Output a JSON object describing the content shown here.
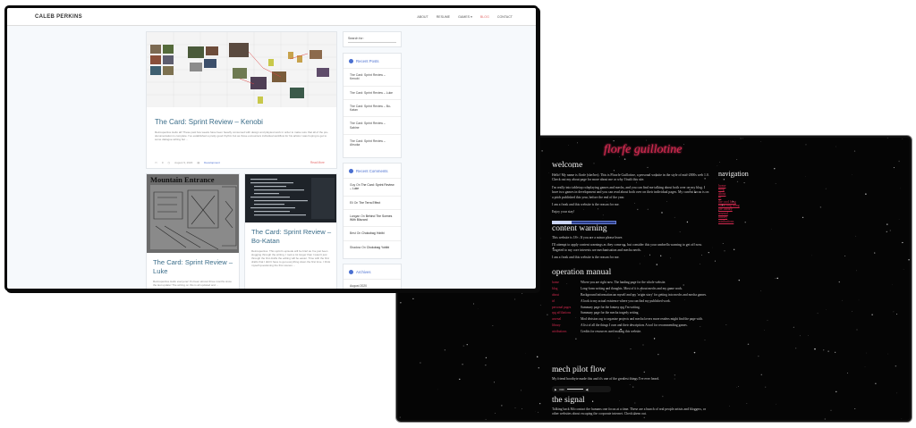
{
  "blog": {
    "brand": "CALEB PERKINS",
    "nav": [
      {
        "label": "ABOUT",
        "active": false
      },
      {
        "label": "RESUME",
        "active": false
      },
      {
        "label": "GAMES ▾",
        "active": false
      },
      {
        "label": "BLOG",
        "active": true
      },
      {
        "label": "CONTACT",
        "active": false
      }
    ],
    "posts": [
      {
        "title": "The Card: Sprint Review – Kenobi",
        "excerpt": "Retrospective Hello all! These past few weeks have been heavily consumed with design and playtest work in order to make sure that all of the pre-documentation is complete. I've established a pretty good rhythm but as those encounters individual workflow for his artists I was hoping to get to some dialogue writing but ...",
        "comments": "0",
        "date": "August 9, 2020",
        "category": "Development",
        "read_more": "Read More"
      },
      {
        "title": "The Card: Sprint Review – Luke",
        "excerpt": "Retrospective Hello everyone! It's been almost three months since the last update! The writing on this is all updated and ..."
      },
      {
        "title": "The Card: Sprint Review – Bo-Katan",
        "excerpt": "Retrospective: This sprint's episode will be brief as I've just been slogging through the writing. I took a lot longer than I wasn't just through the first drafts the editing will be easier. Time with the first drafts that I didn't have to get everything down the first time. I think myself questioning the first scenes ..."
      }
    ],
    "thumb_luke_caption": "Mountain Entrance",
    "search_placeholder": "Search for:",
    "recent_posts_title": "Recent Posts",
    "recent_posts": [
      "The Card: Sprint Review – Kenobi",
      "The Card: Sprint Review – Luke",
      "The Card: Sprint Review – Bo-Katan",
      "The Card: Sprint Review – Sabine",
      "The Card: Sprint Review – Ahsoka"
    ],
    "recent_comments_title": "Recent Comments",
    "recent_comments": [
      {
        "author": "Guy",
        "on": "On",
        "post": "The Card: Sprint Review – Luke"
      },
      {
        "author": "Eli",
        "on": "On",
        "post": "The Terra Effect"
      },
      {
        "author": "Langan",
        "on": "On",
        "post": "Behind The Scenes With Blizzard"
      },
      {
        "author": "Best",
        "on": "On",
        "post": "Chokobag Yobibi"
      },
      {
        "author": "Shadow",
        "on": "On",
        "post": "Chokobag Yobibi"
      }
    ],
    "archives_title": "Archives",
    "archives": [
      "August 2020"
    ]
  },
  "dark": {
    "site_title": "florfe guillotine",
    "welcome_heading": "welcome",
    "welcome_paragraphs": [
      "Hello! My name is florfe (she/her). This is Floorfe Guillotine, a personal website in the style of mid-2000s web 1.0. Check out my about page for more about me or why I built this site.",
      "I'm really into tabletop roleplaying games and mechs, and you can find me talking about both over on my blog. I have two games in development and you can read about both over on their individual pages. My current focus is on a pitch published this year, before the end of the year.",
      "I am a freak and this website is the reason for me.",
      "Enjoy your stay!"
    ],
    "warning_heading": "content warning",
    "warning_paragraphs": [
      "This website is 18+. If you are a minor please leave.",
      "I'll attempt to apply content warnings as they come up, but consider this your umbrella warning to get off now. Targeted to my core interests are mechanisation and mecha nerds.",
      "I am a freak and this website is the reason for me."
    ],
    "manual_heading": "operation manual",
    "manual": [
      {
        "key": "home",
        "value": "Where you are right now. The landing page for the whole website."
      },
      {
        "key": "blog",
        "value": "Long-form writing and thoughts. Most of it is about mechs and my game work."
      },
      {
        "key": "about",
        "value": "Background information on myself and my 'origin story' for getting into mechs and mecha games."
      },
      {
        "key": "irl",
        "value": "A look to my actual existence where you can find my published work."
      },
      {
        "key": "personal pages",
        "value": "Summary page for the fantasy rpg I'm writing."
      },
      {
        "key": "rpg affiliations",
        "value": "Summary page for the mecha tragedy setting."
      },
      {
        "key": "arsenal",
        "value": "Mod division org to organize projects and mecha lovers more readers might find the page with."
      },
      {
        "key": "library",
        "value": "A list of all the things I own and their description. A tool for recommending games."
      },
      {
        "key": "attributions",
        "value": "Credits for resources used making this website."
      }
    ],
    "mech_heading": "mech pilot flow",
    "mech_text": "My friend bootbyte made this and it's one of the greatest things I've ever heard.",
    "audio_time": "0:00",
    "signal_heading": "the signal",
    "signal_text": "Talking back 8th contact the humans one focus at a time. These are a bunch of real people artists and bloggers, or other websites about escaping the corporate internet. Check them out.",
    "nav_heading": "navigation",
    "nav_items": [
      "home",
      "blog",
      "about",
      "irl",
      "the cool blog",
      "the acting thing",
      "the library",
      "arsenal",
      "library",
      "attributions"
    ]
  }
}
